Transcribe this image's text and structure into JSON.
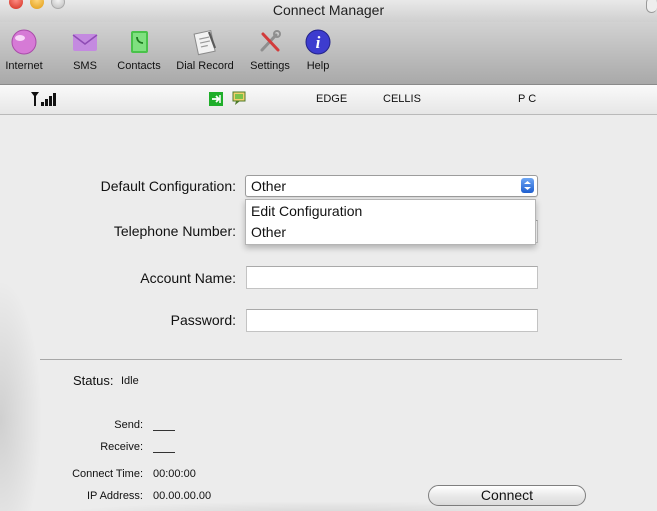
{
  "window": {
    "title": "Connect Manager"
  },
  "toolbar": {
    "items": [
      {
        "label": "Internet",
        "icon": "internet-globe-icon"
      },
      {
        "label": "SMS",
        "icon": "sms-envelope-icon"
      },
      {
        "label": "Contacts",
        "icon": "contacts-book-icon"
      },
      {
        "label": "Dial Record",
        "icon": "dial-record-icon"
      },
      {
        "label": "Settings",
        "icon": "settings-tools-icon"
      },
      {
        "label": "Help",
        "icon": "help-info-icon"
      }
    ]
  },
  "status_strip": {
    "network_mode": "EDGE",
    "operator": "CELLIS",
    "connection_target": "P C"
  },
  "form": {
    "default_configuration": {
      "label": "Default Configuration:",
      "value": "Other",
      "options": [
        "Edit Configuration",
        "Other"
      ]
    },
    "telephone_number": {
      "label": "Telephone Number:",
      "value": ""
    },
    "account_name": {
      "label": "Account Name:",
      "value": ""
    },
    "password": {
      "label": "Password:",
      "value": ""
    }
  },
  "status": {
    "label": "Status:",
    "value": "Idle",
    "send_label": "Send:",
    "receive_label": "Receive:",
    "connect_time_label": "Connect Time:",
    "connect_time": "00:00:00",
    "ip_address_label": "IP Address:",
    "ip_address": "00.00.00.00"
  },
  "buttons": {
    "connect": "Connect"
  },
  "colors": {
    "accent_blue": "#2f6fe0",
    "help_purple": "#3d3ccf",
    "toolbar_gray": "#b9b9b9"
  }
}
